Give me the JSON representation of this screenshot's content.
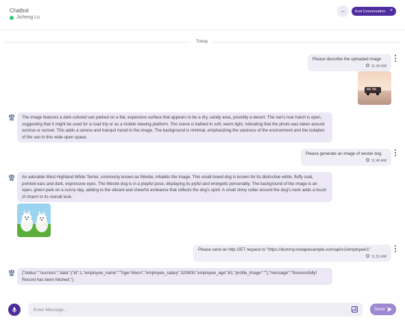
{
  "header": {
    "title": "Chatbot",
    "user_name": "Jicheng Lu",
    "minimize_label": "–",
    "end_label": "End Conversation",
    "end_close": "×",
    "status_color": "#2ecc71"
  },
  "date_separator": "Today",
  "messages": [
    {
      "role": "user",
      "text": "Please describe the uploaded image",
      "time": "11:45 AM"
    },
    {
      "role": "bot",
      "text": "The image features a dark-colored van parked on a flat, expansive surface that appears to be a dry, sandy area, possibly a desert. The van's rear hatch is open, suggesting that it might be used for a road trip or as a mobile viewing platform. The scene is bathed in soft, warm light, indicating that the photo was taken around sunrise or sunset. This adds a serene and tranquil mood to the image. The background is minimal, emphasizing the vastness of the environment and the isolation of the van in this wide-open space."
    },
    {
      "role": "user",
      "text": "Please generate an image of westie dog",
      "time": "11:46 AM"
    },
    {
      "role": "bot",
      "text": "An adorable West Highland White Terrier, commonly known as Westie, inhabits the image. This small breed dog is known for its distinctive white, fluffy coat, pointed ears and dark, expressive eyes. The Westie dog is in a playful pose, displaying its joyful and energetic personality. The background of the image is an open, green park on a sunny day, adding to the vibrant and cheerful ambiance that reflects the dog's spirit. A small shiny collar around the dog's neck adds a touch of charm to its overall look."
    },
    {
      "role": "user",
      "text": "Please send an http GET request to \"https://dummy.restapiexample.com/api/v1/employee/1\"",
      "time": "11:51 AM"
    },
    {
      "role": "bot",
      "text": "{\"status\":\"success\",\"data\":{\"id\":1,\"employee_name\":\"Tiger Nixon\",\"employee_salary\":320800,\"employee_age\":61,\"profile_image\":\"\"},\"message\":\"Successfully! Record has been fetched.\"}"
    }
  ],
  "composer": {
    "placeholder": "Enter Message...",
    "send_label": "Send"
  },
  "colors": {
    "accent": "#4d2c9e",
    "send": "#9e88d1",
    "bubble": "#ebe7f5"
  }
}
